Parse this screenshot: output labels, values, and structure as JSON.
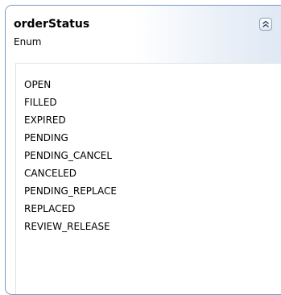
{
  "shape": {
    "name": "orderStatus",
    "stereotype": "Enum",
    "collapse_icon": "double-chevron-up-icon",
    "values": [
      "OPEN",
      "FILLED",
      "EXPIRED",
      "PENDING",
      "PENDING_CANCEL",
      "CANCELED",
      "PENDING_REPLACE",
      "REPLACED",
      "REVIEW_RELEASE"
    ]
  },
  "colors": {
    "border": "#7a9bc4",
    "header_gradient_end": "#dde7f3",
    "text": "#000000"
  }
}
